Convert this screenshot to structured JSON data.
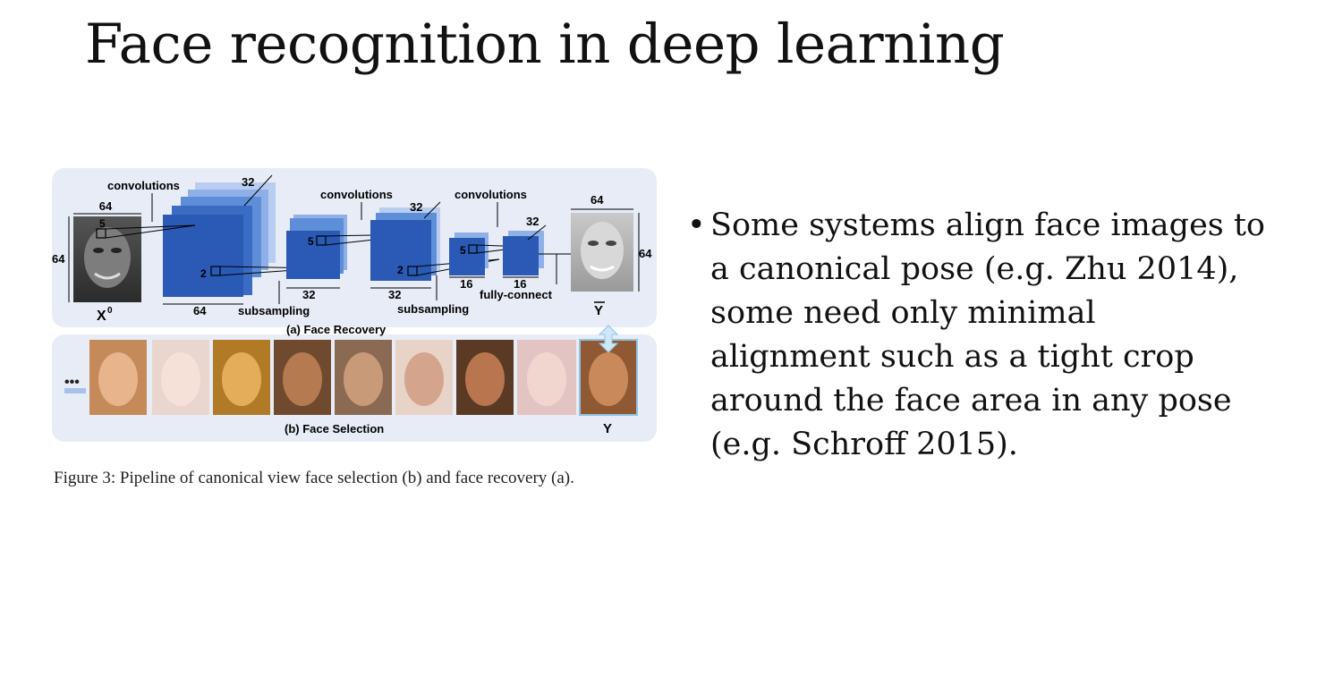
{
  "slide": {
    "title": "Face recognition in deep learning"
  },
  "figure": {
    "caption": "Figure 3: Pipeline of canonical view face selection (b) and face recovery (a).",
    "panel_a_label": "(a) Face Recovery",
    "panel_b_label": "(b) Face Selection",
    "labels": {
      "conv1": "convolutions",
      "conv2": "convolutions",
      "conv3": "convolutions",
      "sub1": "subsampling",
      "sub2": "subsampling",
      "fc": "fully-connect",
      "input_symbol": "X",
      "input_sup": "0",
      "output_symbol": "Y",
      "selected_symbol": "Y",
      "ellipsis": "•••"
    },
    "dims": {
      "in_w": "64",
      "in_h": "64",
      "k1": "5",
      "b1_depth": "32",
      "b1_w": "64",
      "p1": "2",
      "b2_k": "5",
      "b2_w": "32",
      "b3_depth": "32",
      "b3_w": "32",
      "p2": "2",
      "b4_k": "5",
      "b4_w": "16",
      "b5_depth": "32",
      "b5_w": "16",
      "out_w": "64",
      "out_h": "64"
    }
  },
  "bullet": {
    "text": "Some systems align face images to a canonical pose (e.g. Zhu 2014), some need only minimal alignment such as a tight crop around the face area in any pose (e.g. Schroff 2015).",
    "lines": [
      "Some systems align face images to",
      "a canonical pose (e.g. Zhu 2014),",
      "some need only minimal",
      "alignment such as a tight crop",
      "around the face area in any pose",
      "(e.g. Schroff 2015)."
    ]
  }
}
